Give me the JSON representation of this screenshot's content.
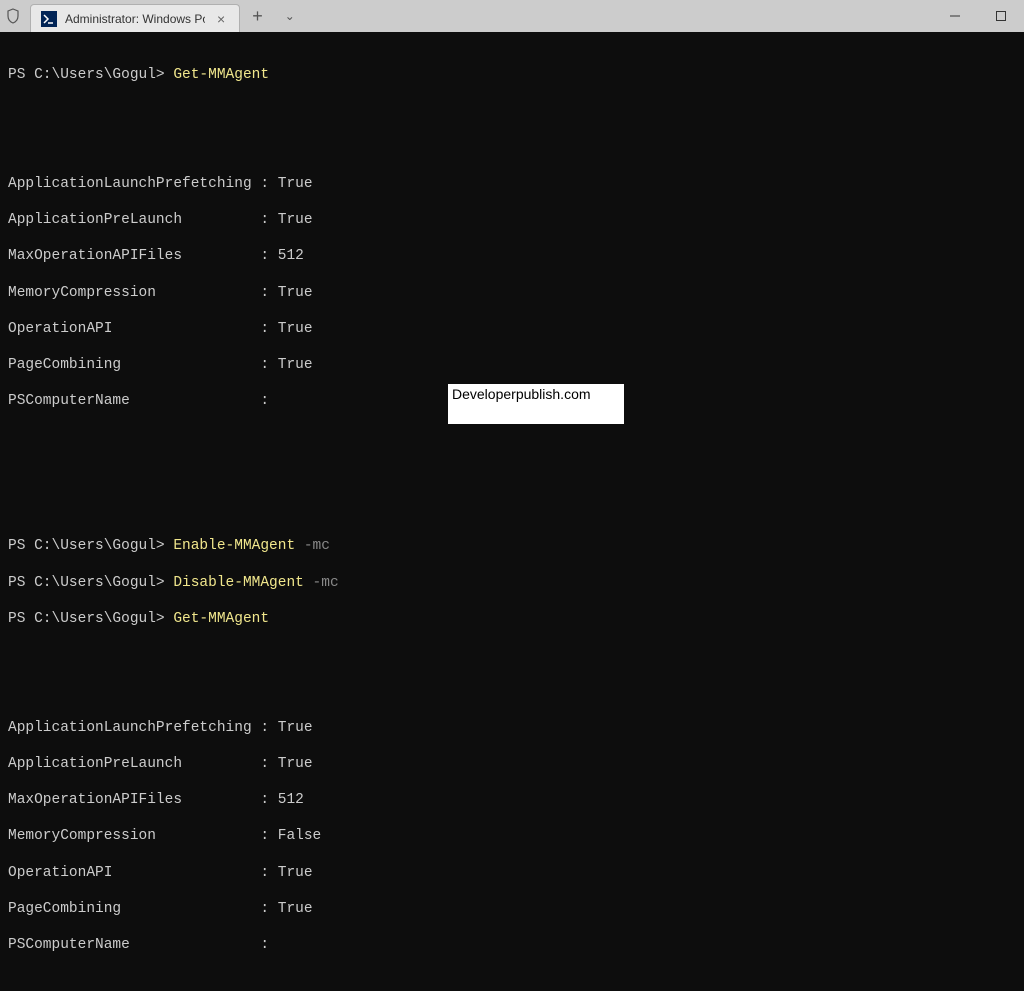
{
  "titlebar": {
    "tab_title": "Administrator: Windows PowerS",
    "tab_close": "×",
    "tab_add": "+",
    "tab_dropdown": "⌄"
  },
  "terminal": {
    "prompt": "PS C:\\Users\\Gogul> ",
    "commands": {
      "getmm1": "Get-MMAgent",
      "enablemm": "Enable-MMAgent",
      "enablemm_param": " -mc",
      "disablemm": "Disable-MMAgent",
      "disablemm_param": " -mc",
      "getmm2": "Get-MMAgent"
    },
    "output1": {
      "line1": "ApplicationLaunchPrefetching : True",
      "line2": "ApplicationPreLaunch         : True",
      "line3": "MaxOperationAPIFiles         : 512",
      "line4": "MemoryCompression            : True",
      "line5": "OperationAPI                 : True",
      "line6": "PageCombining                : True",
      "line7": "PSComputerName               :"
    },
    "output2": {
      "line1": "ApplicationLaunchPrefetching : True",
      "line2": "ApplicationPreLaunch         : True",
      "line3": "MaxOperationAPIFiles         : 512",
      "line4": "MemoryCompression            : False",
      "line5": "OperationAPI                 : True",
      "line6": "PageCombining                : True",
      "line7": "PSComputerName               :"
    }
  },
  "watermark": "Developerpublish.com"
}
